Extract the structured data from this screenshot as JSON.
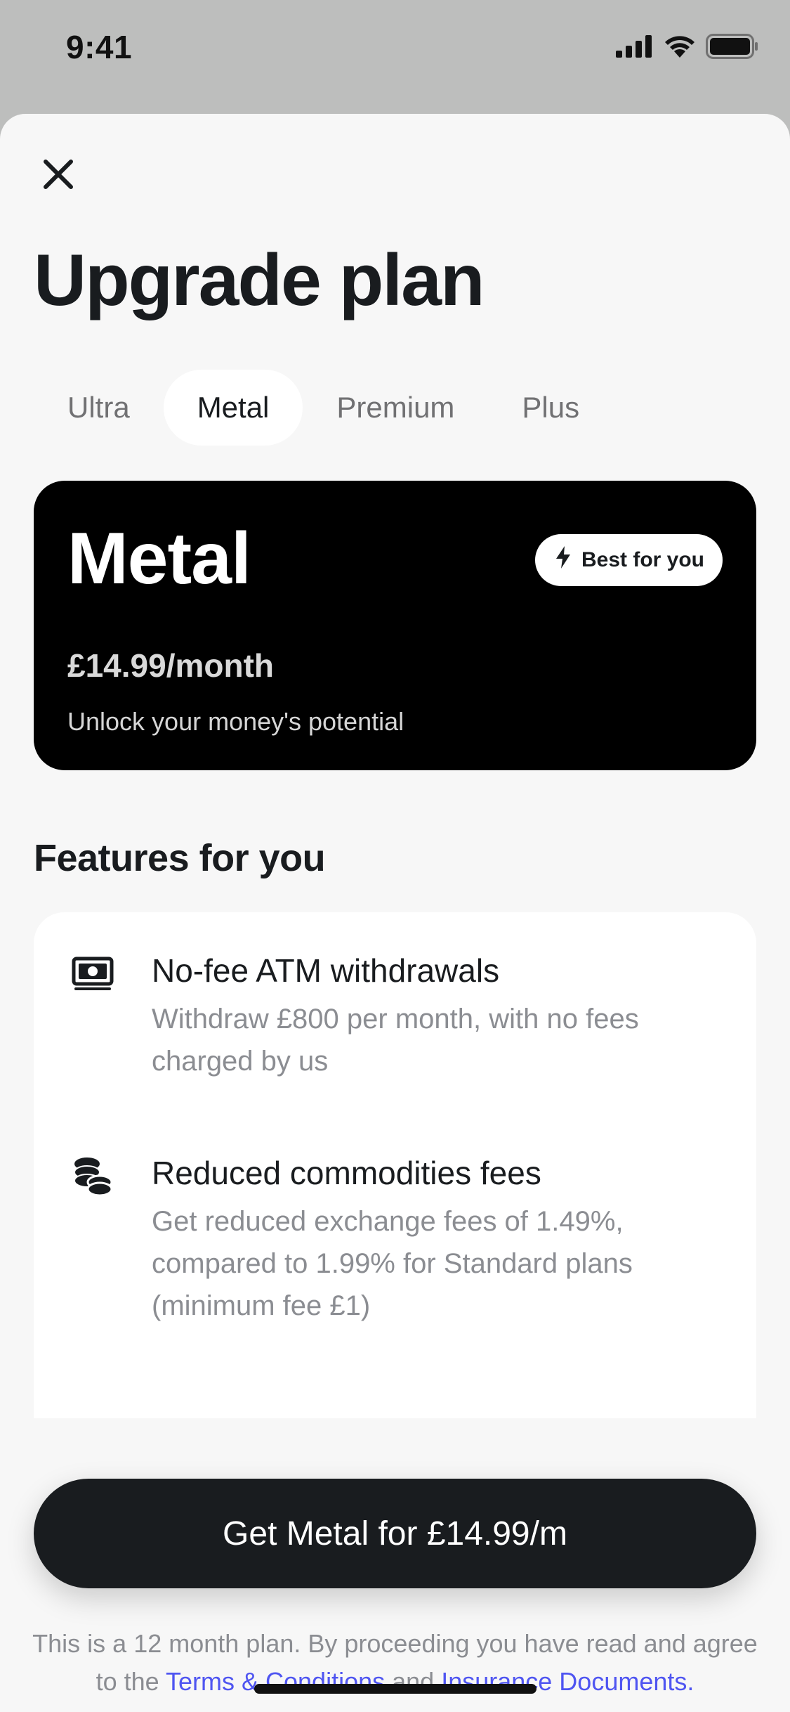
{
  "status_bar": {
    "time": "9:41",
    "icons": [
      "signal-icon",
      "wifi-icon",
      "battery-icon"
    ]
  },
  "header": {
    "close_icon": "close-icon",
    "title": "Upgrade plan"
  },
  "tabs": [
    {
      "label": "Ultra",
      "active": false
    },
    {
      "label": "Metal",
      "active": true
    },
    {
      "label": "Premium",
      "active": false
    },
    {
      "label": "Plus",
      "active": false
    }
  ],
  "plan_card": {
    "name": "Metal",
    "badge_icon": "lightning-icon",
    "badge_label": "Best for you",
    "price": "£14.99/month",
    "tagline": "Unlock your money's potential"
  },
  "features": {
    "section_title": "Features for you",
    "items": [
      {
        "icon": "cash-note-icon",
        "title": "No-fee ATM withdrawals",
        "description": "Withdraw £800 per month, with no fees charged by us"
      },
      {
        "icon": "coins-stack-icon",
        "title": "Reduced commodities fees",
        "description": "Get reduced exchange fees of 1.49%, compared to 1.99% for Standard plans (minimum fee £1)"
      }
    ]
  },
  "cta": {
    "label": "Get Metal for £14.99/m"
  },
  "disclaimer": {
    "text_before": "This is a 12 month plan. By proceeding you have read and agree to the ",
    "terms_link": "Terms & Conditions",
    "text_middle": " and ",
    "insurance_link": "Insurance Documents",
    "text_after": "."
  },
  "colors": {
    "backdrop": "#bdbebd",
    "sheet": "#f7f7f7",
    "card_dark": "#000000",
    "button_dark": "#191c1f",
    "link": "#4f55f1",
    "muted_text": "#8b8d92"
  }
}
